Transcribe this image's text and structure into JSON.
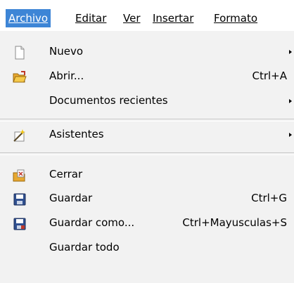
{
  "menubar": {
    "items": [
      {
        "label": "Archivo",
        "active": true
      },
      {
        "label": "Editar",
        "active": false
      },
      {
        "label": "Ver",
        "active": false
      },
      {
        "label": "Insertar",
        "active": false
      },
      {
        "label": "Formato",
        "active": false
      }
    ]
  },
  "menu": {
    "items": [
      {
        "label": "Nuevo",
        "shortcut": "",
        "submenu": true,
        "icon": "new-document-icon"
      },
      {
        "label": "Abrir...",
        "shortcut": "Ctrl+A",
        "submenu": false,
        "icon": "open-folder-icon"
      },
      {
        "label": "Documentos recientes",
        "shortcut": "",
        "submenu": true,
        "icon": ""
      },
      {
        "label": "Asistentes",
        "shortcut": "",
        "submenu": true,
        "icon": "wizard-icon"
      },
      {
        "label": "Cerrar",
        "shortcut": "",
        "submenu": false,
        "icon": "close-document-icon"
      },
      {
        "label": "Guardar",
        "shortcut": "Ctrl+G",
        "submenu": false,
        "icon": "save-icon"
      },
      {
        "label": "Guardar como...",
        "shortcut": "Ctrl+Mayusculas+S",
        "submenu": false,
        "icon": "save-as-icon"
      },
      {
        "label": "Guardar todo",
        "shortcut": "",
        "submenu": false,
        "icon": ""
      }
    ]
  },
  "colors": {
    "active_menu_bg": "#3d85d6",
    "menu_bg": "#f2f2f2"
  }
}
